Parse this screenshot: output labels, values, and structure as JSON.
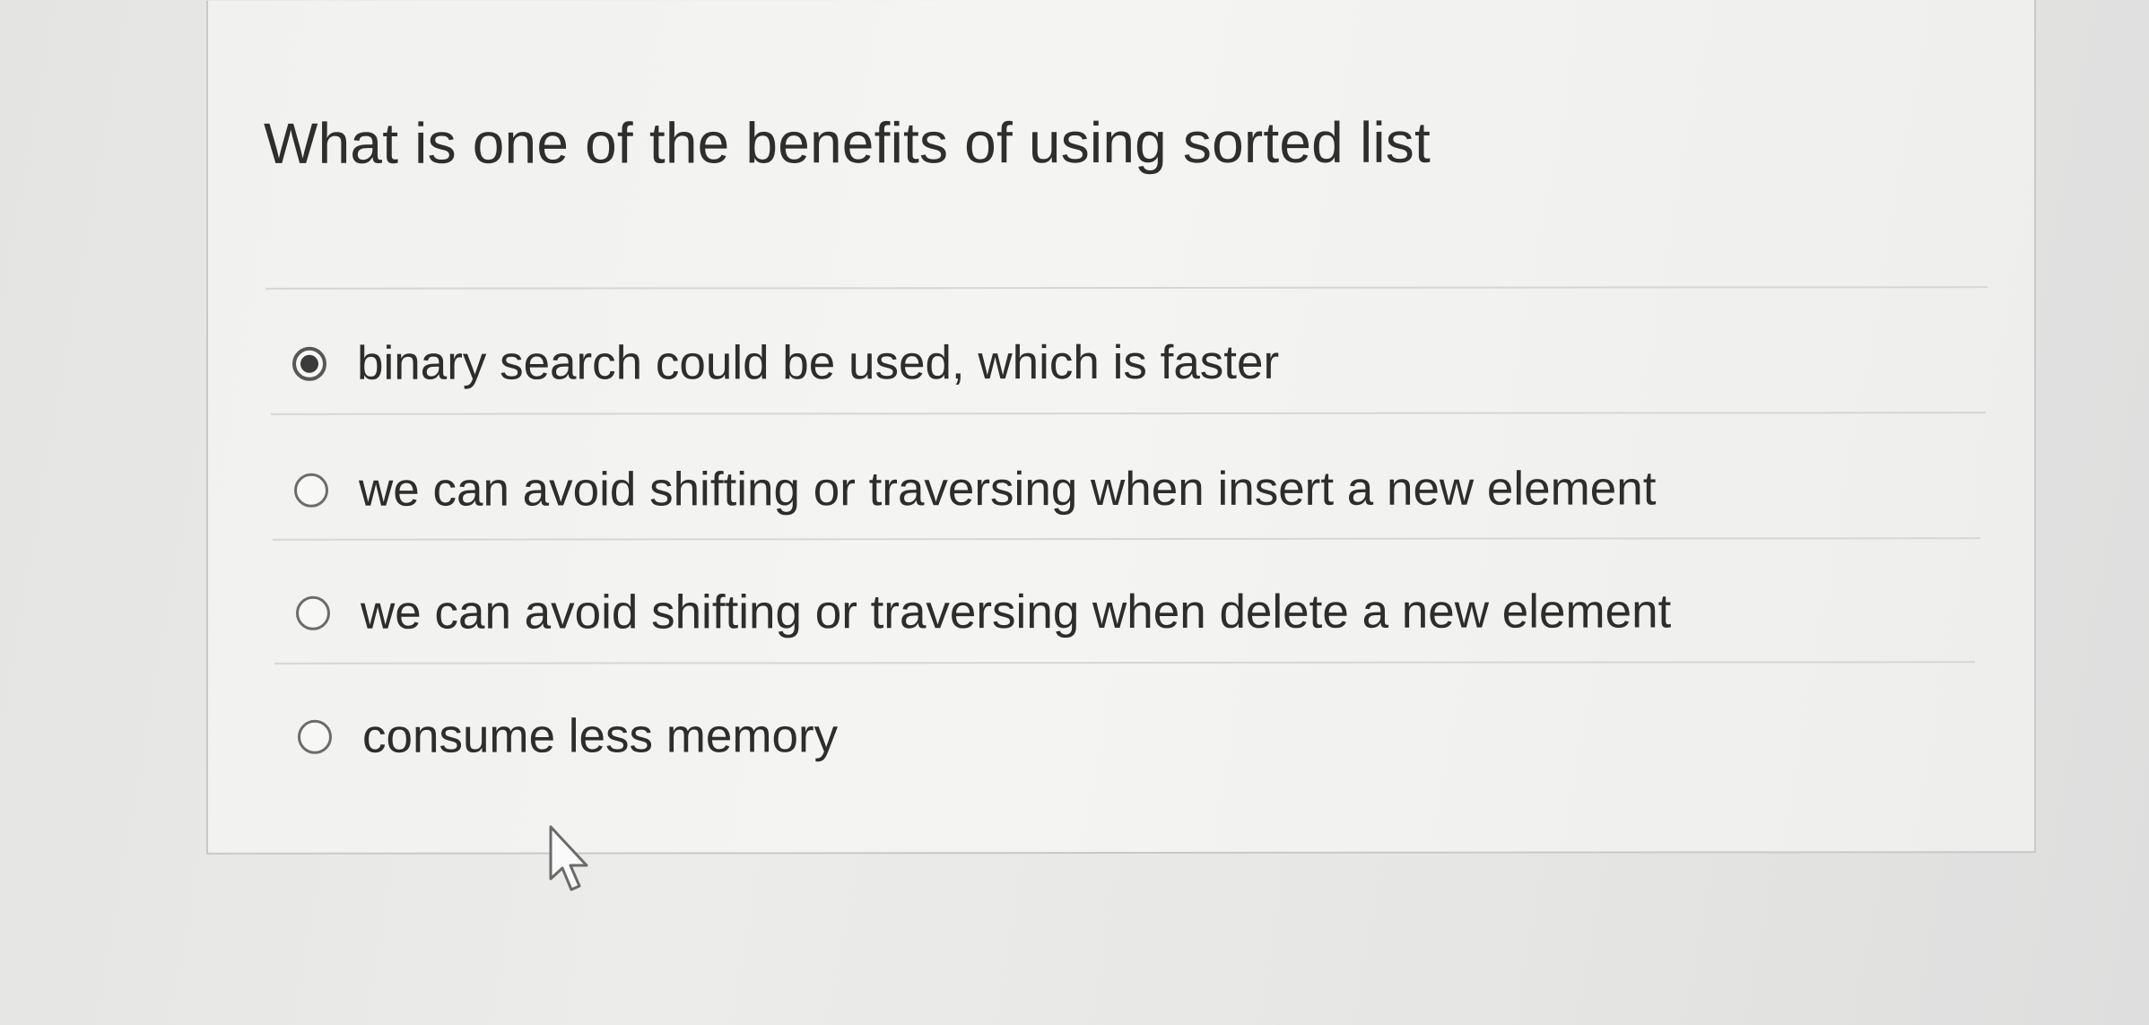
{
  "question": {
    "text": "What is one of the benefits of using sorted list"
  },
  "options": [
    {
      "label": "binary search could be used, which is faster",
      "selected": true
    },
    {
      "label": "we can avoid shifting or traversing when insert a new element",
      "selected": false
    },
    {
      "label": "we can avoid shifting or traversing when delete a new element",
      "selected": false
    },
    {
      "label": "consume less memory",
      "selected": false
    }
  ],
  "cursor": {
    "icon": "arrow-pointer-icon"
  }
}
